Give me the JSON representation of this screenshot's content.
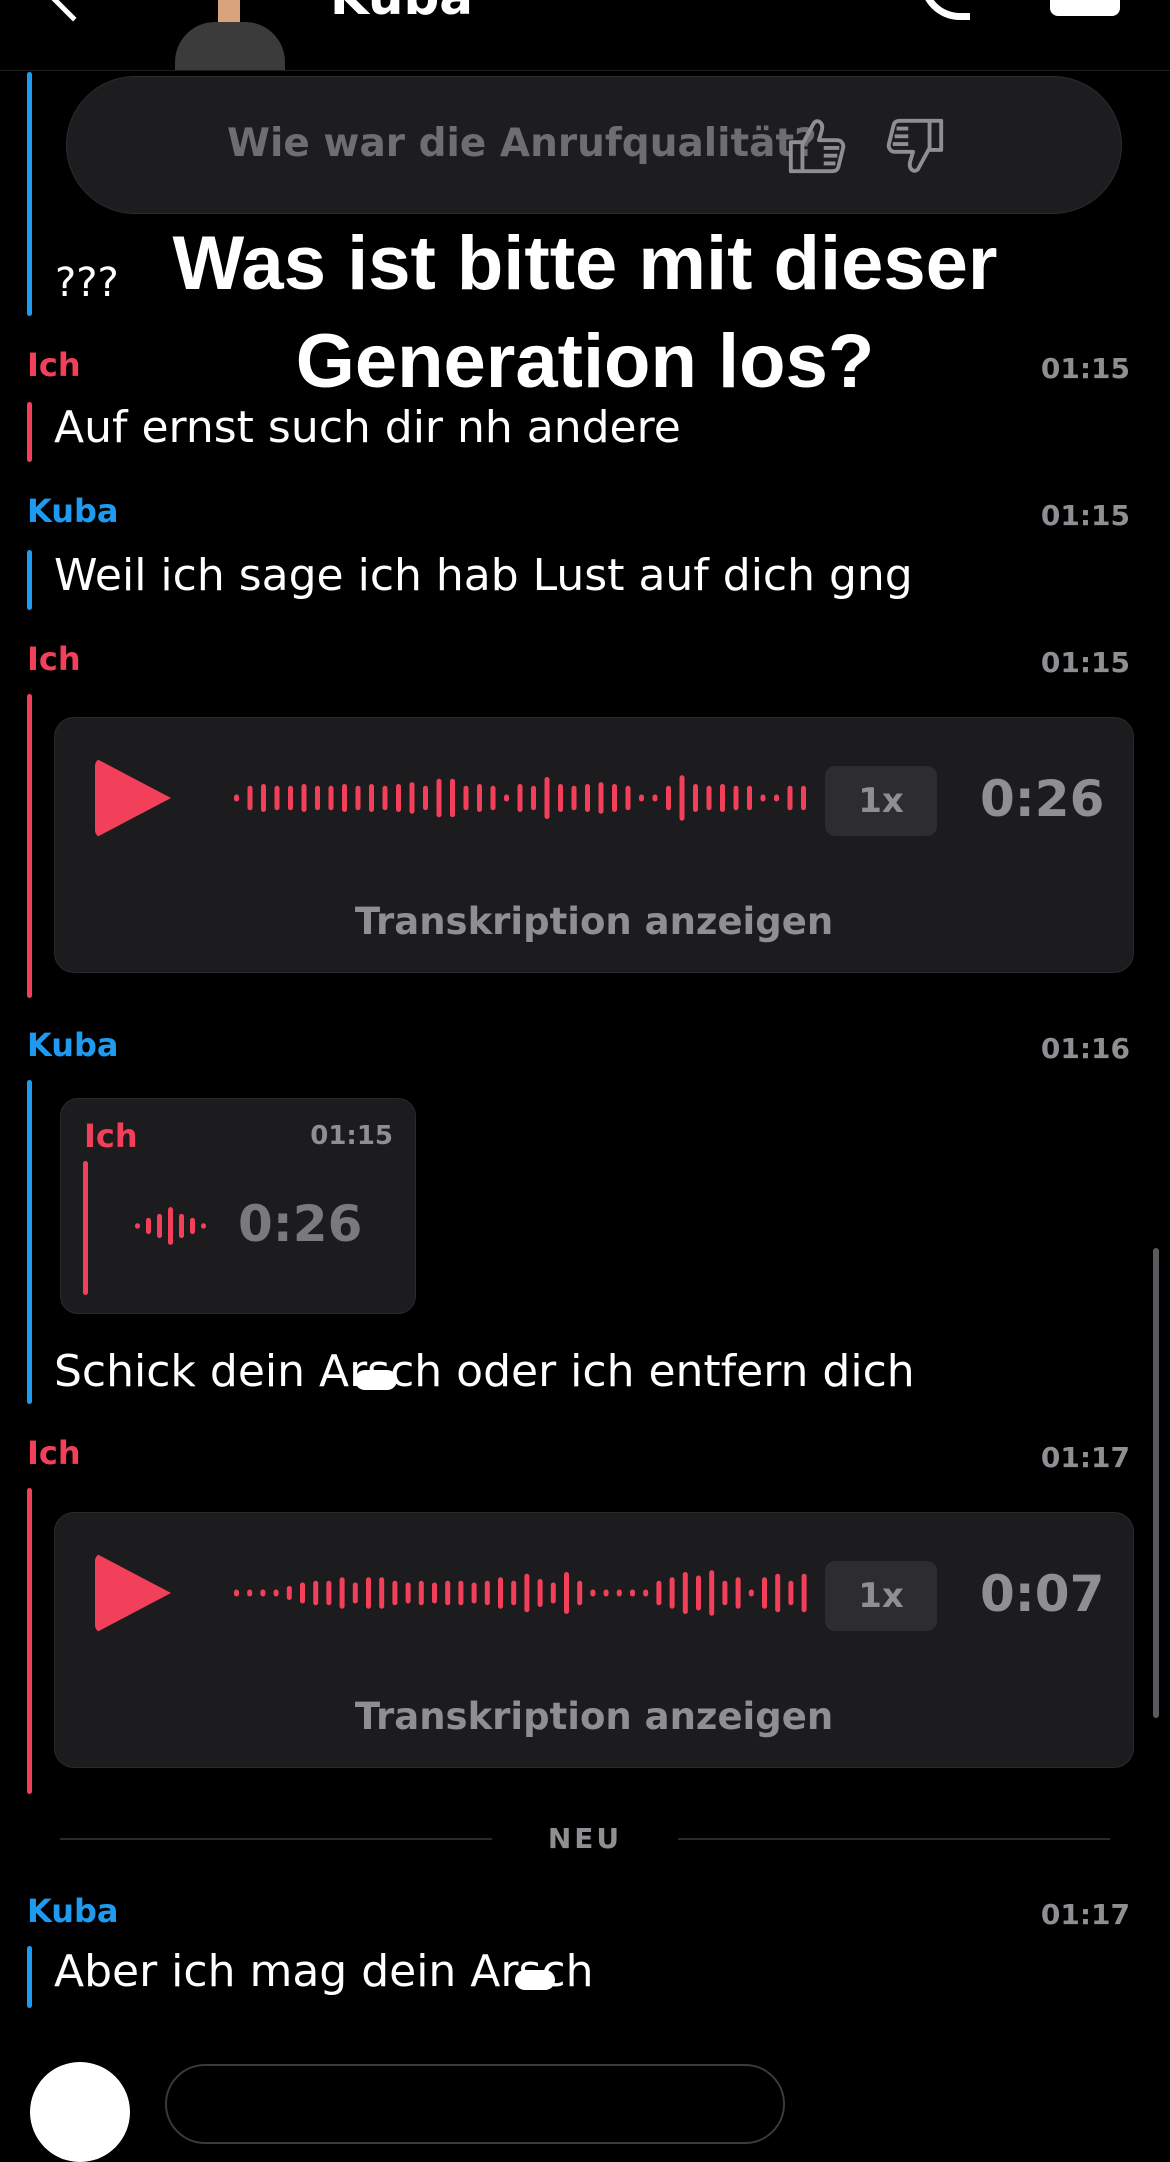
{
  "header": {
    "contact_name": "Kuba"
  },
  "call_quality": {
    "question": "Wie war die Anrufqualität?"
  },
  "overlay_caption": {
    "line1": "Was ist bitte mit dieser",
    "line2": "Generation los?"
  },
  "colors": {
    "me": "#f2405a",
    "contact": "#1e9bf0",
    "card_bg": "#1c1c1e",
    "muted_text": "#8e8e93"
  },
  "messages": [
    {
      "sender": "",
      "text": "???"
    },
    {
      "sender": "Ich",
      "time": "01:15",
      "text": "Auf ernst such dir nh andere"
    },
    {
      "sender": "Kuba",
      "time": "01:15",
      "text": "Weil ich sage ich hab Lust auf dich gng"
    },
    {
      "sender": "Ich",
      "time": "01:15",
      "voice": {
        "speed": "1x",
        "duration": "0:26",
        "transcribe_label": "Transkription anzeigen"
      }
    },
    {
      "sender": "Kuba",
      "time": "01:16",
      "quote": {
        "sender": "Ich",
        "time": "01:15",
        "duration": "0:26"
      },
      "text": "Schick dein Arsch oder ich entfern dich"
    },
    {
      "sender": "Ich",
      "time": "01:17",
      "voice": {
        "speed": "1x",
        "duration": "0:07",
        "transcribe_label": "Transkription anzeigen"
      }
    },
    {
      "sender": "Kuba",
      "time": "01:17",
      "text": "Aber ich mag dein Arsch"
    }
  ],
  "divider": {
    "label": "NEU"
  }
}
